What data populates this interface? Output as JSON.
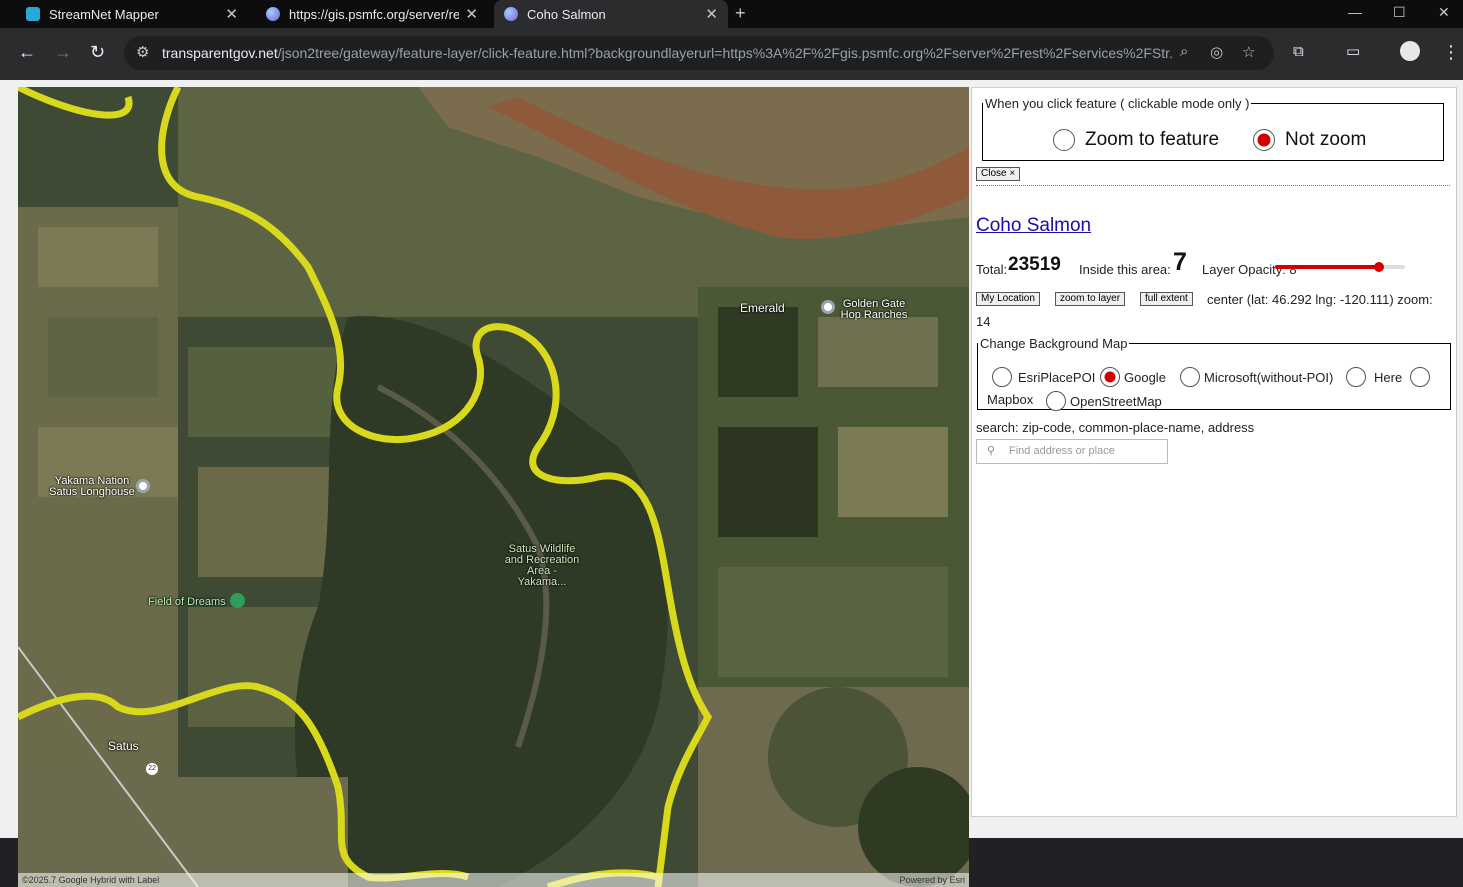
{
  "browser": {
    "tabs": [
      {
        "label": "StreamNet Mapper",
        "color": "#2aa7d8"
      },
      {
        "label": "https://gis.psmfc.org/server/res",
        "color": "#7b5cd6"
      },
      {
        "label": "Coho Salmon",
        "color": "#7b5cd6"
      }
    ],
    "url_host": "transparentgov.net",
    "url_path": "/json2tree/gateway/feature-layer/click-feature.html?backgroundlayerurl=https%3A%2F%2Fgis.psmfc.org%2Fserver%2Frest%2Fservices%2FStr..."
  },
  "map": {
    "labels": {
      "emerald": "Emerald",
      "golden_gate": "Golden Gate Hop Ranches",
      "yakama": "Yakama Nation Satus Longhouse",
      "satus_wildlife": "Satus Wildlife and Recreation Area - Yakama...",
      "field_of_dreams": "Field of Dreams",
      "satus": "Satus",
      "route": "22"
    },
    "attribution_left": "©2025.7 Google Hybrid with Label",
    "attribution_right": "Powered by Esri",
    "colors": {
      "stream": "#d8d81c",
      "farm_light": "#7c7a55",
      "farm_dark": "#2e3a22",
      "ridge": "#8e5a3a"
    }
  },
  "panel": {
    "click_legend": "When you click feature ( clickable mode only )",
    "zoom_to_feature": "Zoom to feature",
    "not_zoom": "Not zoom",
    "selected_click": "Not zoom",
    "close_label": "Close ×",
    "layer_title": "Coho Salmon",
    "total_label": "Total:",
    "total_value": "23519",
    "inside_label": "Inside this area:",
    "inside_value": "7",
    "opacity_label": "Layer Opacity: 8",
    "opacity_fraction": 0.8,
    "my_location": "My Location",
    "zoom_to_layer": "zoom to layer",
    "full_extent": "full extent",
    "center_text": "center (lat: 46.292 lng: -120.111) zoom:",
    "zoom_value": "14",
    "bg_legend": "Change Background Map",
    "bg_options": [
      "EsriPlacePOI",
      "Google",
      "Microsoft(without-POI)",
      "Here",
      "Mapbox",
      "OpenStreetMap"
    ],
    "bg_selected": "Google",
    "search_label": "search: zip-code, common-place-name, address",
    "search_placeholder": "Find address or place",
    "accent": "#d40000"
  }
}
